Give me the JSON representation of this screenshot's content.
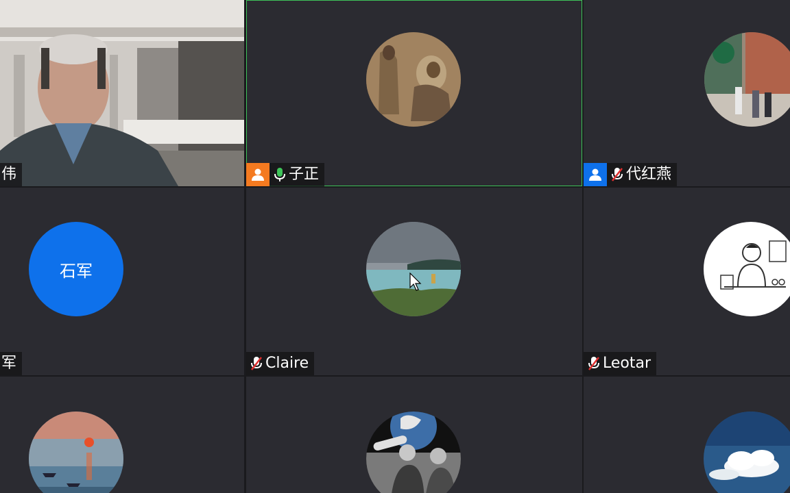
{
  "participants": [
    {
      "name": "伟",
      "mic": "none",
      "badge": "none",
      "kind": "video"
    },
    {
      "name": "子正",
      "mic": "on",
      "badge": "orange",
      "kind": "avatar",
      "avatar_icon": "buddha-painting-avatar"
    },
    {
      "name": "代红燕",
      "mic": "muted",
      "badge": "blue",
      "kind": "avatar",
      "avatar_icon": "street-photo-avatar"
    },
    {
      "name": "军",
      "mic": "none",
      "badge": "none",
      "kind": "initials",
      "initials": "石军"
    },
    {
      "name": "Claire",
      "mic": "muted",
      "badge": "none",
      "kind": "avatar",
      "avatar_icon": "lake-landscape-avatar"
    },
    {
      "name": "Leotar",
      "mic": "muted",
      "badge": "none",
      "kind": "avatar",
      "avatar_icon": "sketch-person-avatar"
    },
    {
      "name": "",
      "mic": "none",
      "badge": "none",
      "kind": "avatar",
      "avatar_icon": "impression-sunrise-avatar"
    },
    {
      "name": "",
      "mic": "none",
      "badge": "none",
      "kind": "avatar",
      "avatar_icon": "kids-telescope-earth-avatar"
    },
    {
      "name": "",
      "mic": "none",
      "badge": "none",
      "kind": "avatar",
      "avatar_icon": "cloud-sky-avatar"
    }
  ],
  "colors": {
    "tile_bg": "#2b2b31",
    "active_speaker_border": "#3ec55a",
    "host_badge_orange": "#f47a20",
    "cohost_badge_blue": "#0e71eb",
    "initials_avatar": "#0e71eb",
    "muted_icon": "#e02f2f",
    "mic_on_icon": "#3ec55a"
  }
}
